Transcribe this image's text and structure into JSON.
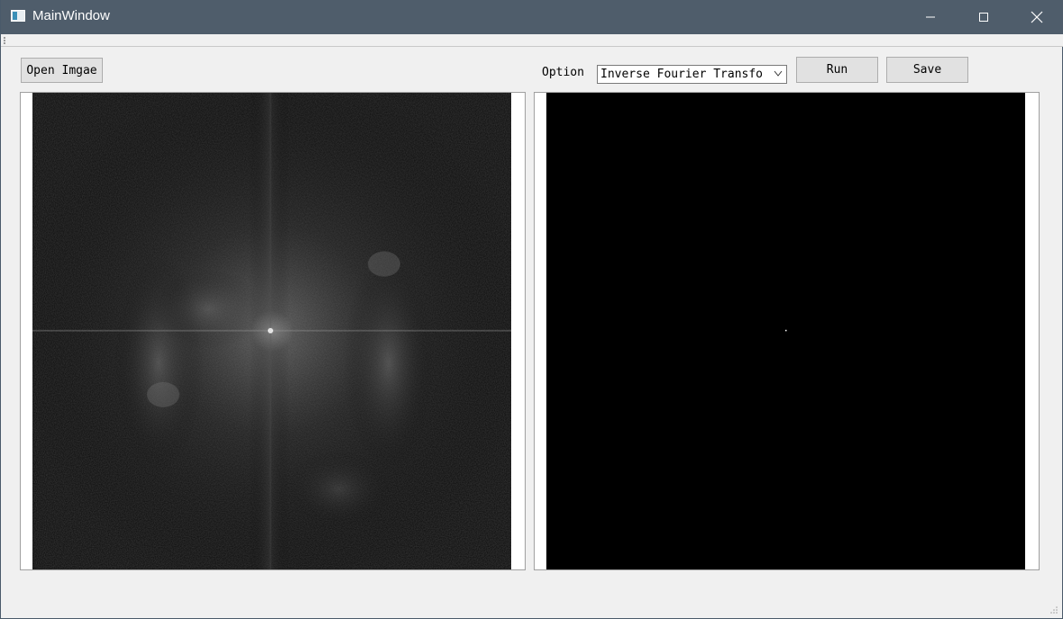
{
  "window": {
    "title": "MainWindow"
  },
  "toolbar": {
    "open_label": "Open Imgae",
    "option_label": "Option",
    "option_selected": "Inverse Fourier Transfo",
    "run_label": "Run",
    "save_label": "Save"
  },
  "icons": {
    "app": "window-icon",
    "minimize": "minimize-icon",
    "maximize": "maximize-icon",
    "close": "close-icon",
    "dropdown": "chevron-down-icon",
    "resize": "size-grip-icon"
  },
  "colors": {
    "titlebar": "#4f5d6b",
    "window_bg": "#f0f0f0",
    "button_bg": "#e1e1e1",
    "image_bg": "#000000"
  }
}
